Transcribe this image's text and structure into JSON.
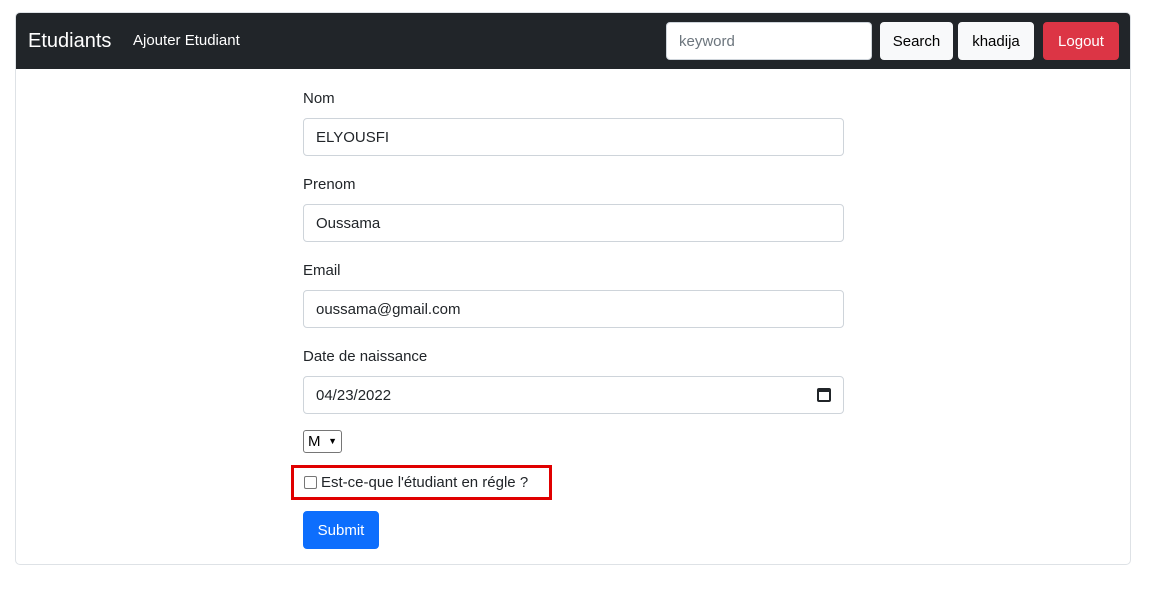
{
  "navbar": {
    "brand": "Etudiants",
    "add_link": "Ajouter Etudiant",
    "search_placeholder": "keyword",
    "search_value": "",
    "search_button": "Search",
    "user_button": "khadija",
    "logout_button": "Logout"
  },
  "form": {
    "nom_label": "Nom",
    "nom_value": "ELYOUSFI",
    "prenom_label": "Prenom",
    "prenom_value": "Oussama",
    "email_label": "Email",
    "email_value": "oussama@gmail.com",
    "date_label": "Date de naissance",
    "date_value": "04/23/2022",
    "genre_value": "M",
    "en_regle_label": "Est-ce-que l'étudiant en régle ?",
    "en_regle_checked": false,
    "submit_label": "Submit"
  },
  "colors": {
    "navbar_bg": "#212529",
    "logout": "#dc3545",
    "submit": "#0d6efd",
    "highlight": "#e00000"
  },
  "icons": {
    "date_picker": "calendar-icon",
    "select_caret": "chevron-down-icon"
  }
}
